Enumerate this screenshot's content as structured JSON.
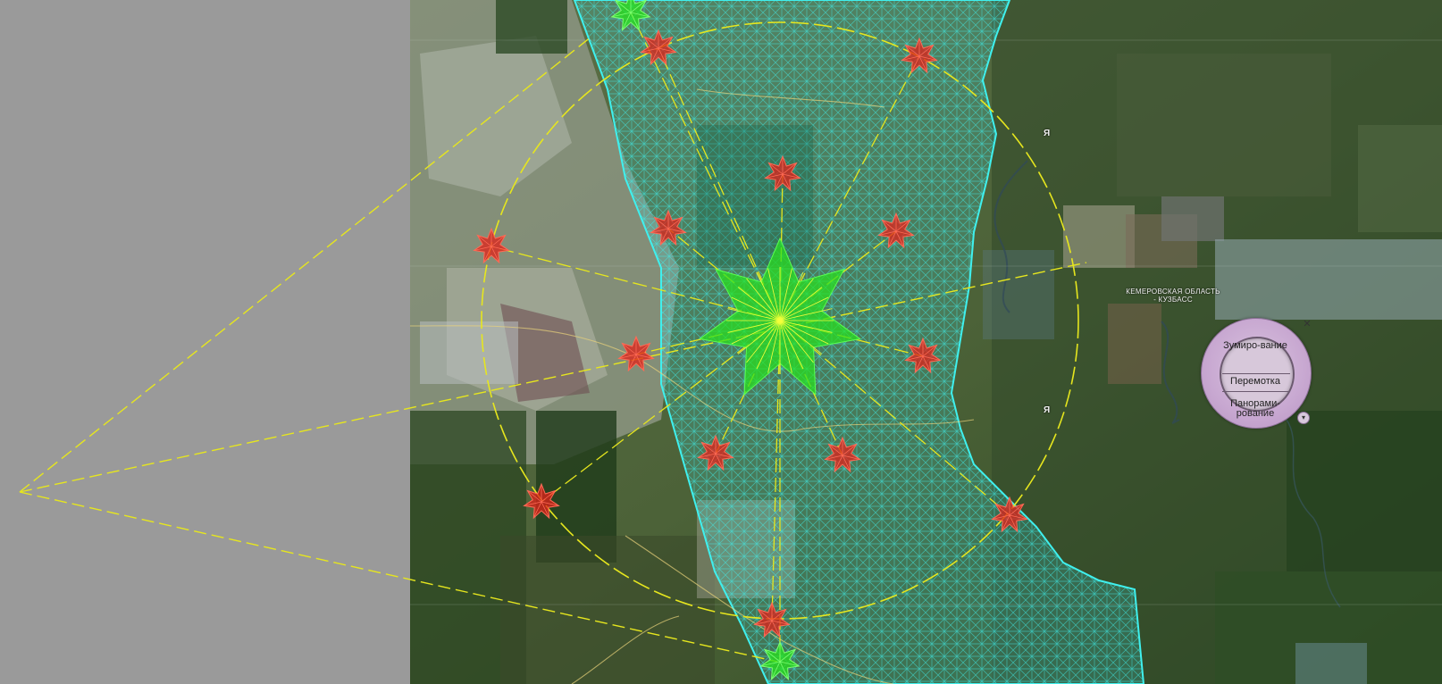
{
  "map": {
    "region_label": "КЕМЕРОВСКАЯ ОБЛАСТЬ - КУЗБАСС",
    "letter_north": "Я",
    "letter_south": "Я"
  },
  "navigation": {
    "zoom_label": "Зумиро-вание",
    "rewind_label": "Перемотка",
    "pan_label": "Панорами-рование",
    "close_symbol": "✕",
    "chevron_symbol": "▾"
  },
  "colors": {
    "grid_overlay": "#3ff0ee",
    "guide_lines": "#e6e61e",
    "red_star": "#e0211a",
    "green_star": "#28e11e",
    "left_panel": "#9a9a9a",
    "nav_control": "#c9a9d2"
  },
  "icons": {
    "close": "close-icon",
    "chevron": "chevron-down-icon",
    "star": "star-marker-icon"
  }
}
